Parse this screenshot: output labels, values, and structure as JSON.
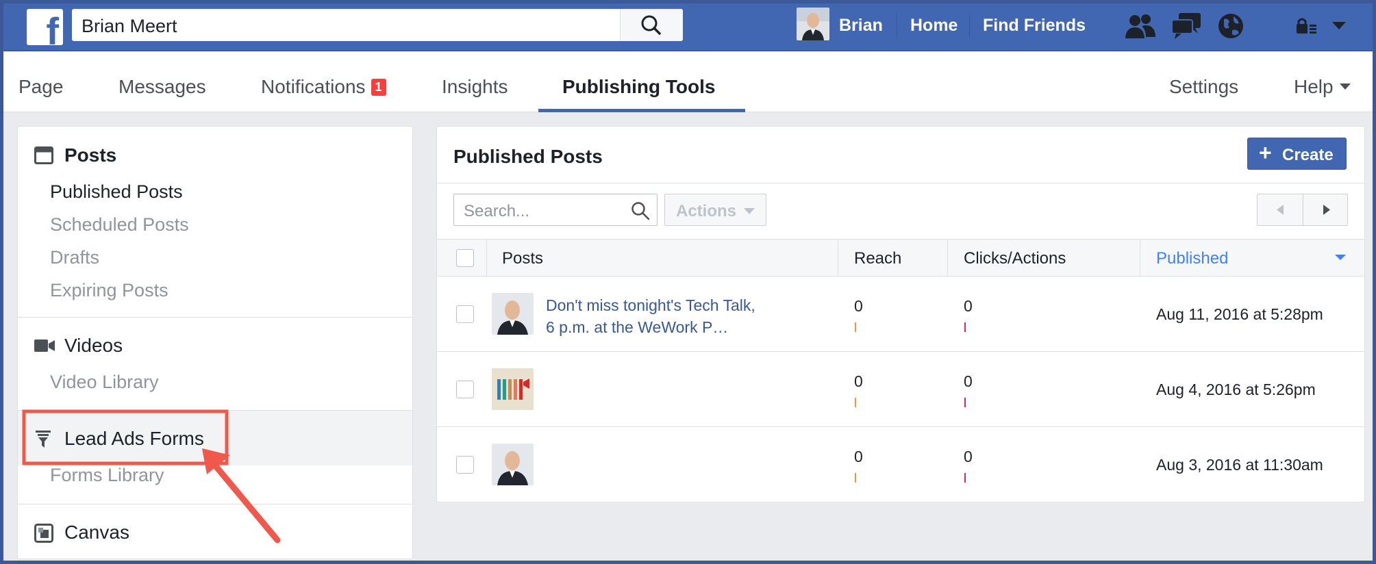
{
  "topbar": {
    "search_value": "Brian Meert",
    "user_name": "Brian",
    "nav_home": "Home",
    "nav_find_friends": "Find Friends",
    "brand_color": "#4267b2"
  },
  "tabs": {
    "page": "Page",
    "messages": "Messages",
    "notifications": "Notifications",
    "notifications_count": "1",
    "insights": "Insights",
    "publishing_tools": "Publishing Tools",
    "settings": "Settings",
    "help": "Help"
  },
  "sidebar": {
    "posts_header": "Posts",
    "posts_items": [
      "Published Posts",
      "Scheduled Posts",
      "Drafts",
      "Expiring Posts"
    ],
    "videos_header": "Videos",
    "videos_items": [
      "Video Library"
    ],
    "lead_ads_header": "Lead Ads Forms",
    "lead_ads_items": [
      "Forms Library"
    ],
    "canvas_header": "Canvas"
  },
  "main": {
    "title": "Published Posts",
    "create_label": "Create",
    "search_placeholder": "Search...",
    "actions_label": "Actions",
    "columns": [
      "Posts",
      "Reach",
      "Clicks/Actions",
      "Published"
    ],
    "rows": [
      {
        "text": "Don't miss tonight's Tech Talk, 6 p.m. at the WeWork P…",
        "reach": "0",
        "clicks": "0",
        "published": "Aug 11, 2016 at 5:28pm"
      },
      {
        "text": "",
        "reach": "0",
        "clicks": "0",
        "published": "Aug 4, 2016 at 5:26pm"
      },
      {
        "text": "",
        "reach": "0",
        "clicks": "0",
        "published": "Aug 3, 2016 at 11:30am"
      }
    ]
  },
  "annotation": {
    "highlight_color": "#f0584b"
  }
}
